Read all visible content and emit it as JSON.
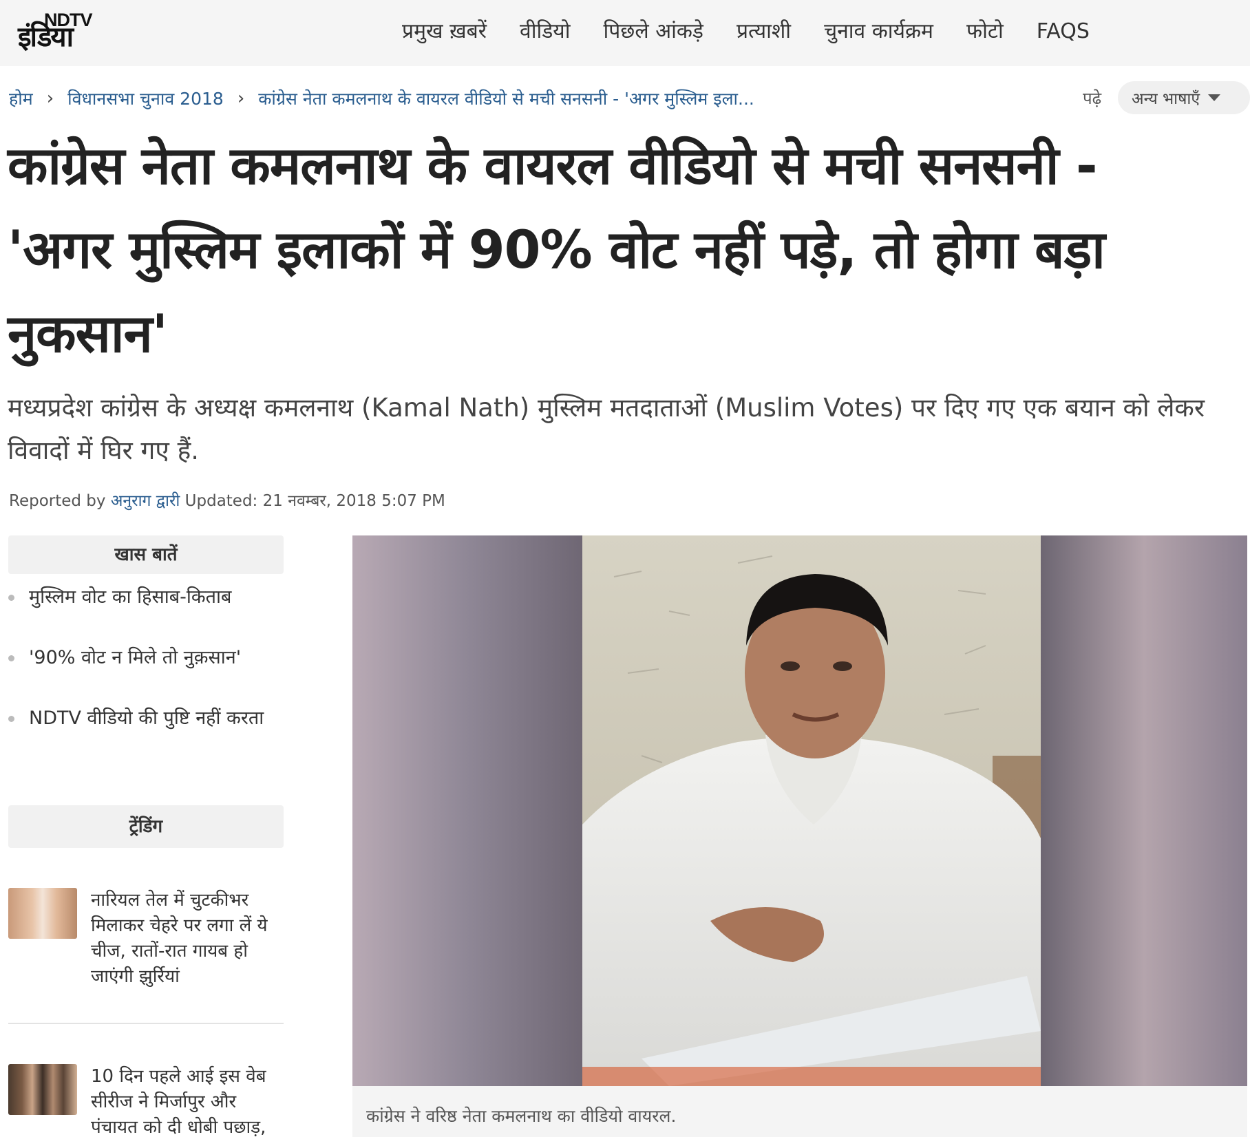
{
  "brand": {
    "logo_top": "NDTV",
    "logo_bottom": "इंडिया"
  },
  "nav": [
    {
      "label": "प्रमुख ख़बरें"
    },
    {
      "label": "वीडियो"
    },
    {
      "label": "पिछले आंकड़े"
    },
    {
      "label": "प्रत्याशी"
    },
    {
      "label": "चुनाव कार्यक्रम"
    },
    {
      "label": "फोटो"
    },
    {
      "label": "FAQS"
    }
  ],
  "breadcrumb": {
    "home": "होम",
    "section": "विधानसभा चुनाव 2018",
    "current": "कांग्रेस नेता कमलनाथ के वायरल वीडियो से मची सनसनी - 'अगर मुस्लिम इला..."
  },
  "language": {
    "read_label": "पढ़े",
    "button_label": "अन्य भाषाएँ"
  },
  "article": {
    "headline": "कांग्रेस नेता कमलनाथ के वायरल वीडियो से मची सनसनी - 'अगर मुस्लिम इलाकों में 90% वोट नहीं पड़े, तो होगा बड़ा नुकसान'",
    "summary": "मध्यप्रदेश कांग्रेस के अध्यक्ष कमलनाथ (Kamal Nath) मुस्लिम मतदाताओं (Muslim Votes) पर दिए गए एक बयान को लेकर विवादों में घिर गए हैं.",
    "reported_by_label": "Reported by",
    "author": "अनुराग द्वारी",
    "updated": "Updated: 21 नवम्बर, 2018 5:07 PM",
    "caption": "कांग्रेस ने वरिष्ठ नेता कमलनाथ का वीडियो वायरल."
  },
  "highlights": {
    "title": "खास बातें",
    "items": [
      "मुस्लिम वोट का हिसाब-किताब",
      "'90% वोट न मिले तो नुक़सान'",
      "NDTV वीडियो की पुष्टि नहीं करता"
    ]
  },
  "trending": {
    "title": "ट्रेंडिंग",
    "items": [
      {
        "text": "नारियल तेल में चुटकीभर मिलाकर चेहरे पर लगा लें ये चीज, रातों-रात गायब हो जाएंगी झुर्रियां"
      },
      {
        "text": "10 दिन पहले आई इस वेब सीरीज ने मिर्जापुर और पंचायत को दी धोबी पछाड़,"
      }
    ]
  },
  "colors": {
    "link": "#2a5d8f",
    "header_bg": "#f5f5f5",
    "text": "#222222"
  }
}
